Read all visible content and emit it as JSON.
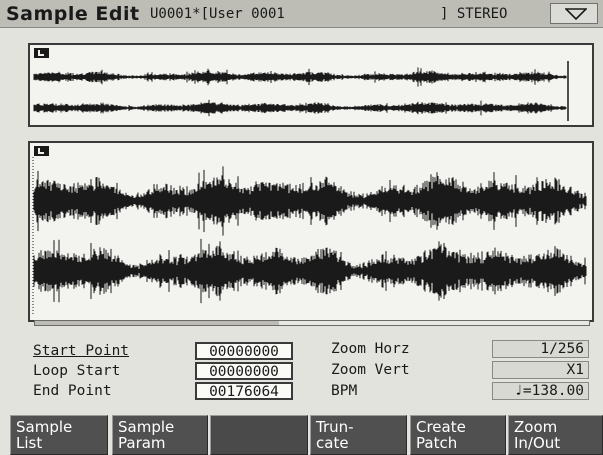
{
  "header": {
    "title": "Sample Edit",
    "sample_name": "U0001*[User 0001",
    "channel": "] STEREO"
  },
  "waveform": {
    "overview_channel_icon": "left-channel-icon",
    "detail_channel_icon": "left-channel-icon"
  },
  "params_left": [
    {
      "label": "Start Point",
      "value": "00000000"
    },
    {
      "label": "Loop Start",
      "value": "00000000"
    },
    {
      "label": "End Point",
      "value": "00176064"
    }
  ],
  "params_right": [
    {
      "label": "Zoom Horz",
      "value": "1/256"
    },
    {
      "label": "Zoom Vert",
      "value": "X1"
    },
    {
      "label": "BPM",
      "value": "♩=138.00"
    }
  ],
  "function_buttons": [
    {
      "line1": "Sample",
      "line2": "List"
    },
    {
      "line1": "Sample",
      "line2": "Param"
    },
    {
      "line1": "",
      "line2": ""
    },
    {
      "line1": "Trun-",
      "line2": "cate"
    },
    {
      "line1": "Create",
      "line2": "Patch"
    },
    {
      "line1": "Zoom",
      "line2": "In/Out"
    }
  ],
  "colors": {
    "background": "#e3e3de",
    "waveform": "#1a1a1a",
    "function_button": "#505050"
  }
}
